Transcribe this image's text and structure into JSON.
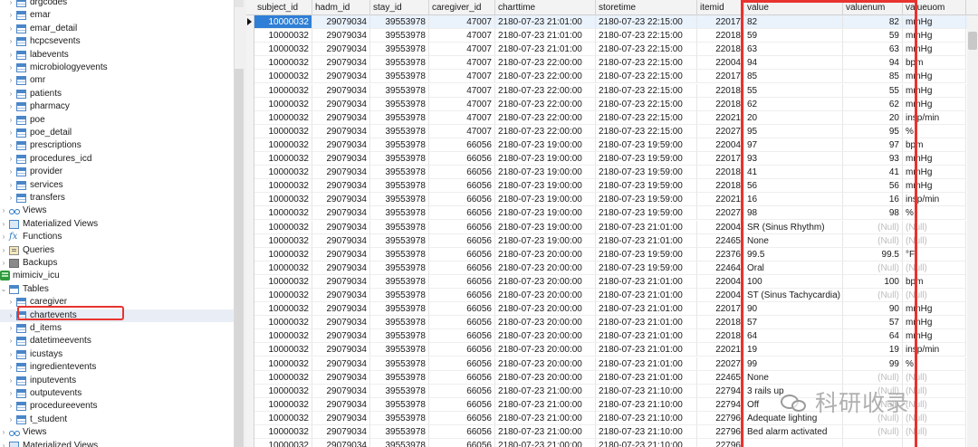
{
  "navigator": {
    "items": [
      {
        "label": "drgcodes",
        "type": "table",
        "indent": 1
      },
      {
        "label": "emar",
        "type": "table",
        "indent": 1
      },
      {
        "label": "emar_detail",
        "type": "table",
        "indent": 1
      },
      {
        "label": "hcpcsevents",
        "type": "table",
        "indent": 1
      },
      {
        "label": "labevents",
        "type": "table",
        "indent": 1
      },
      {
        "label": "microbiologyevents",
        "type": "table",
        "indent": 1
      },
      {
        "label": "omr",
        "type": "table",
        "indent": 1
      },
      {
        "label": "patients",
        "type": "table",
        "indent": 1
      },
      {
        "label": "pharmacy",
        "type": "table",
        "indent": 1
      },
      {
        "label": "poe",
        "type": "table",
        "indent": 1
      },
      {
        "label": "poe_detail",
        "type": "table",
        "indent": 1
      },
      {
        "label": "prescriptions",
        "type": "table",
        "indent": 1
      },
      {
        "label": "procedures_icd",
        "type": "table",
        "indent": 1
      },
      {
        "label": "provider",
        "type": "table",
        "indent": 1
      },
      {
        "label": "services",
        "type": "table",
        "indent": 1
      },
      {
        "label": "transfers",
        "type": "table",
        "indent": 1
      },
      {
        "label": "Views",
        "type": "views",
        "indent": 0
      },
      {
        "label": "Materialized Views",
        "type": "mview",
        "indent": 0
      },
      {
        "label": "Functions",
        "type": "func",
        "indent": 0
      },
      {
        "label": "Queries",
        "type": "query",
        "indent": 0
      },
      {
        "label": "Backups",
        "type": "backup",
        "indent": 0
      },
      {
        "label": "mimiciv_icu",
        "type": "db",
        "indent": -1
      },
      {
        "label": "Tables",
        "type": "tables",
        "indent": 0
      },
      {
        "label": "caregiver",
        "type": "table",
        "indent": 1
      },
      {
        "label": "chartevents",
        "type": "table",
        "indent": 1,
        "selected": true
      },
      {
        "label": "d_items",
        "type": "table",
        "indent": 1
      },
      {
        "label": "datetimeevents",
        "type": "table",
        "indent": 1
      },
      {
        "label": "icustays",
        "type": "table",
        "indent": 1
      },
      {
        "label": "ingredientevents",
        "type": "table",
        "indent": 1
      },
      {
        "label": "inputevents",
        "type": "table",
        "indent": 1
      },
      {
        "label": "outputevents",
        "type": "table",
        "indent": 1
      },
      {
        "label": "procedureevents",
        "type": "table",
        "indent": 1
      },
      {
        "label": "t_student",
        "type": "table",
        "indent": 1
      },
      {
        "label": "Views",
        "type": "views",
        "indent": 0
      },
      {
        "label": "Materialized Views",
        "type": "mview",
        "indent": 0
      }
    ]
  },
  "grid": {
    "columns": [
      "subject_id",
      "hadm_id",
      "stay_id",
      "caregiver_id",
      "charttime",
      "storetime",
      "itemid",
      "value",
      "valuenum",
      "valueuom"
    ],
    "rows": [
      [
        "10000032",
        "29079034",
        "39553978",
        "47007",
        "2180-07-23 21:01:00",
        "2180-07-23 22:15:00",
        "22017",
        "82",
        "82",
        "mmHg"
      ],
      [
        "10000032",
        "29079034",
        "39553978",
        "47007",
        "2180-07-23 21:01:00",
        "2180-07-23 22:15:00",
        "22018",
        "59",
        "59",
        "mmHg"
      ],
      [
        "10000032",
        "29079034",
        "39553978",
        "47007",
        "2180-07-23 21:01:00",
        "2180-07-23 22:15:00",
        "22018",
        "63",
        "63",
        "mmHg"
      ],
      [
        "10000032",
        "29079034",
        "39553978",
        "47007",
        "2180-07-23 22:00:00",
        "2180-07-23 22:15:00",
        "22004",
        "94",
        "94",
        "bpm"
      ],
      [
        "10000032",
        "29079034",
        "39553978",
        "47007",
        "2180-07-23 22:00:00",
        "2180-07-23 22:15:00",
        "22017",
        "85",
        "85",
        "mmHg"
      ],
      [
        "10000032",
        "29079034",
        "39553978",
        "47007",
        "2180-07-23 22:00:00",
        "2180-07-23 22:15:00",
        "22018",
        "55",
        "55",
        "mmHg"
      ],
      [
        "10000032",
        "29079034",
        "39553978",
        "47007",
        "2180-07-23 22:00:00",
        "2180-07-23 22:15:00",
        "22018",
        "62",
        "62",
        "mmHg"
      ],
      [
        "10000032",
        "29079034",
        "39553978",
        "47007",
        "2180-07-23 22:00:00",
        "2180-07-23 22:15:00",
        "22021",
        "20",
        "20",
        "insp/min"
      ],
      [
        "10000032",
        "29079034",
        "39553978",
        "47007",
        "2180-07-23 22:00:00",
        "2180-07-23 22:15:00",
        "22027",
        "95",
        "95",
        "%"
      ],
      [
        "10000032",
        "29079034",
        "39553978",
        "66056",
        "2180-07-23 19:00:00",
        "2180-07-23 19:59:00",
        "22004",
        "97",
        "97",
        "bpm"
      ],
      [
        "10000032",
        "29079034",
        "39553978",
        "66056",
        "2180-07-23 19:00:00",
        "2180-07-23 19:59:00",
        "22017",
        "93",
        "93",
        "mmHg"
      ],
      [
        "10000032",
        "29079034",
        "39553978",
        "66056",
        "2180-07-23 19:00:00",
        "2180-07-23 19:59:00",
        "22018",
        "41",
        "41",
        "mmHg"
      ],
      [
        "10000032",
        "29079034",
        "39553978",
        "66056",
        "2180-07-23 19:00:00",
        "2180-07-23 19:59:00",
        "22018",
        "56",
        "56",
        "mmHg"
      ],
      [
        "10000032",
        "29079034",
        "39553978",
        "66056",
        "2180-07-23 19:00:00",
        "2180-07-23 19:59:00",
        "22021",
        "16",
        "16",
        "insp/min"
      ],
      [
        "10000032",
        "29079034",
        "39553978",
        "66056",
        "2180-07-23 19:00:00",
        "2180-07-23 19:59:00",
        "22027",
        "98",
        "98",
        "%"
      ],
      [
        "10000032",
        "29079034",
        "39553978",
        "66056",
        "2180-07-23 19:00:00",
        "2180-07-23 21:01:00",
        "22004",
        "SR (Sinus Rhythm)",
        "(Null)",
        "(Null)"
      ],
      [
        "10000032",
        "29079034",
        "39553978",
        "66056",
        "2180-07-23 19:00:00",
        "2180-07-23 21:01:00",
        "22465",
        "None",
        "(Null)",
        "(Null)"
      ],
      [
        "10000032",
        "29079034",
        "39553978",
        "66056",
        "2180-07-23 20:00:00",
        "2180-07-23 19:59:00",
        "22376",
        "99.5",
        "99.5",
        "°F"
      ],
      [
        "10000032",
        "29079034",
        "39553978",
        "66056",
        "2180-07-23 20:00:00",
        "2180-07-23 19:59:00",
        "22464",
        "Oral",
        "(Null)",
        "(Null)"
      ],
      [
        "10000032",
        "29079034",
        "39553978",
        "66056",
        "2180-07-23 20:00:00",
        "2180-07-23 21:01:00",
        "22004",
        "100",
        "100",
        "bpm"
      ],
      [
        "10000032",
        "29079034",
        "39553978",
        "66056",
        "2180-07-23 20:00:00",
        "2180-07-23 21:01:00",
        "22004",
        "ST (Sinus Tachycardia)",
        "(Null)",
        "(Null)"
      ],
      [
        "10000032",
        "29079034",
        "39553978",
        "66056",
        "2180-07-23 20:00:00",
        "2180-07-23 21:01:00",
        "22017",
        "90",
        "90",
        "mmHg"
      ],
      [
        "10000032",
        "29079034",
        "39553978",
        "66056",
        "2180-07-23 20:00:00",
        "2180-07-23 21:01:00",
        "22018",
        "57",
        "57",
        "mmHg"
      ],
      [
        "10000032",
        "29079034",
        "39553978",
        "66056",
        "2180-07-23 20:00:00",
        "2180-07-23 21:01:00",
        "22018",
        "64",
        "64",
        "mmHg"
      ],
      [
        "10000032",
        "29079034",
        "39553978",
        "66056",
        "2180-07-23 20:00:00",
        "2180-07-23 21:01:00",
        "22021",
        "19",
        "19",
        "insp/min"
      ],
      [
        "10000032",
        "29079034",
        "39553978",
        "66056",
        "2180-07-23 20:00:00",
        "2180-07-23 21:01:00",
        "22027",
        "99",
        "99",
        "%"
      ],
      [
        "10000032",
        "29079034",
        "39553978",
        "66056",
        "2180-07-23 20:00:00",
        "2180-07-23 21:01:00",
        "22465",
        "None",
        "(Null)",
        "(Null)"
      ],
      [
        "10000032",
        "29079034",
        "39553978",
        "66056",
        "2180-07-23 21:00:00",
        "2180-07-23 21:10:00",
        "22794",
        "3 rails up",
        "(Null)",
        "(Null)"
      ],
      [
        "10000032",
        "29079034",
        "39553978",
        "66056",
        "2180-07-23 21:00:00",
        "2180-07-23 21:10:00",
        "22794",
        "Off",
        "(Null)",
        "(Null)"
      ],
      [
        "10000032",
        "29079034",
        "39553978",
        "66056",
        "2180-07-23 21:00:00",
        "2180-07-23 21:10:00",
        "22796",
        "Adequate lighting",
        "(Null)",
        "(Null)"
      ],
      [
        "10000032",
        "29079034",
        "39553978",
        "66056",
        "2180-07-23 21:00:00",
        "2180-07-23 21:10:00",
        "22796",
        "Bed alarm activated",
        "(Null)",
        "(Null)"
      ],
      [
        "10000032",
        "29079034",
        "39553978",
        "66056",
        "2180-07-23 21:00:00",
        "2180-07-23 21:10:00",
        "22796",
        "",
        "",
        ""
      ]
    ]
  },
  "watermark": {
    "text": "科研收录"
  },
  "colors": {
    "highlight_red": "#e8332f",
    "selection_blue": "#2f7fd6",
    "table_icon": "#4a86c8"
  }
}
